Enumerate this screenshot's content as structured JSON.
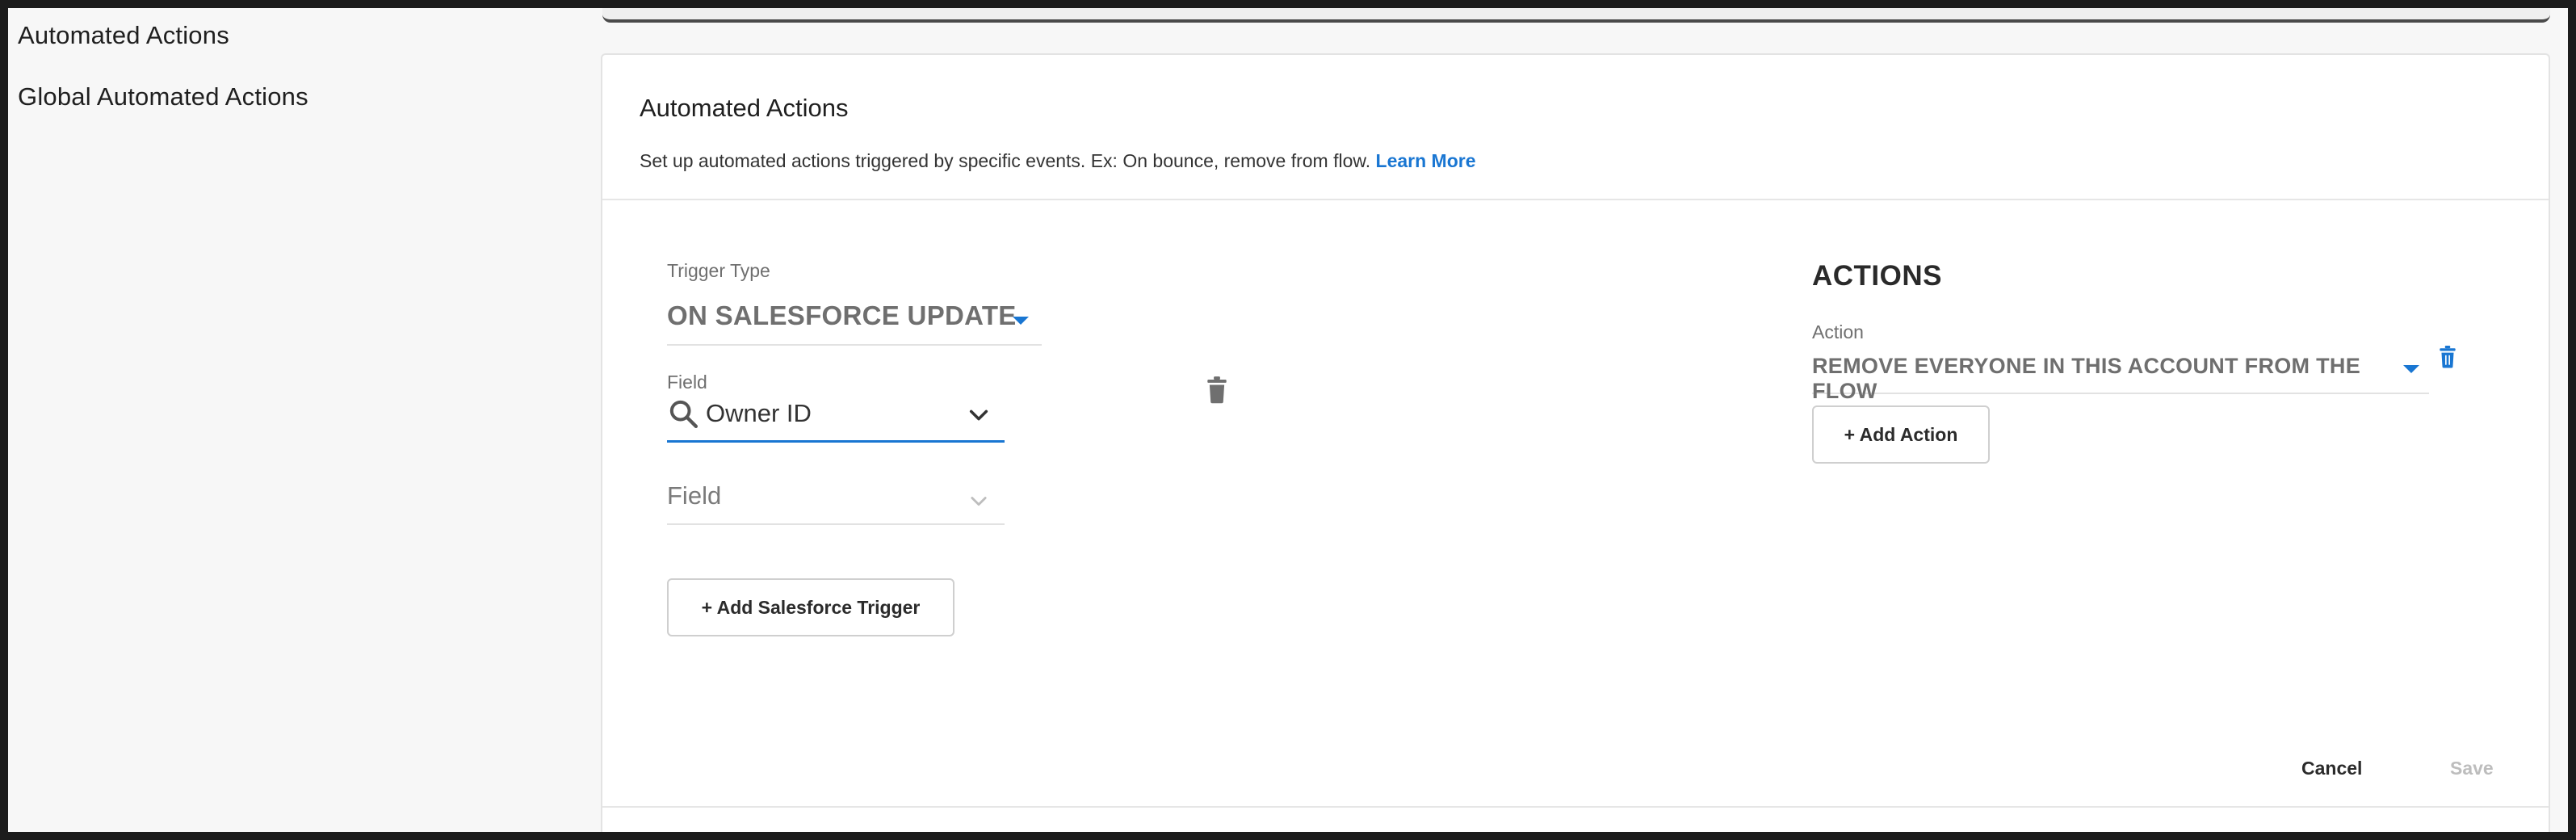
{
  "sidebar": {
    "items": [
      {
        "label": "Automated Actions"
      },
      {
        "label": "Global Automated Actions"
      }
    ]
  },
  "card": {
    "title": "Automated Actions",
    "description": "Set up automated actions triggered by specific events. Ex: On bounce, remove from flow.",
    "learn_more": "Learn More"
  },
  "trigger": {
    "type_label": "Trigger Type",
    "type_value": "ON SALESFORCE UPDATE",
    "field_label": "Field",
    "field_value": "Owner ID",
    "field2_placeholder": "Field",
    "add_trigger_label": "+ Add Salesforce Trigger"
  },
  "actions": {
    "heading": "ACTIONS",
    "action_label": "Action",
    "action_value": "REMOVE EVERYONE IN THIS ACCOUNT FROM THE FLOW",
    "add_action_label": "+ Add Action"
  },
  "footer": {
    "cancel_label": "Cancel",
    "save_label": "Save"
  },
  "colors": {
    "accent": "#1976d2",
    "muted_text": "#6f6f6f",
    "disabled_text": "#bdbdbd"
  },
  "icons": {
    "search": "search-icon",
    "chevron": "chevron-down-icon",
    "caret": "caret-down-icon",
    "trash": "trash-icon"
  }
}
